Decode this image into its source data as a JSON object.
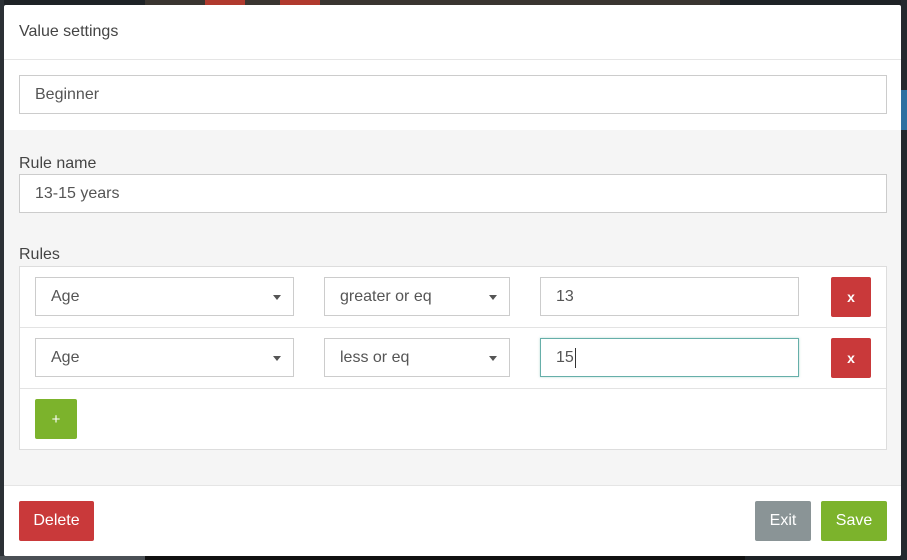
{
  "modal": {
    "title": "Value settings"
  },
  "value": {
    "current": "Beginner"
  },
  "rule": {
    "name_label": "Rule name",
    "name_value": "13-15 years",
    "rules_label": "Rules",
    "rows": [
      {
        "field": "Age",
        "operator": "greater or eq",
        "value": "13",
        "remove_label": "x"
      },
      {
        "field": "Age",
        "operator": "less or eq",
        "value": "15",
        "remove_label": "x"
      }
    ],
    "add_label": "+"
  },
  "footer": {
    "delete_label": "Delete",
    "exit_label": "Exit",
    "save_label": "Save"
  },
  "colors": {
    "danger": "#c9393a",
    "success": "#7cb32c",
    "neutral": "#8a9496",
    "focus": "#66afa9"
  },
  "icons": {
    "dropdown": "caret-down-icon",
    "remove": "close-icon",
    "add": "plus-icon"
  }
}
